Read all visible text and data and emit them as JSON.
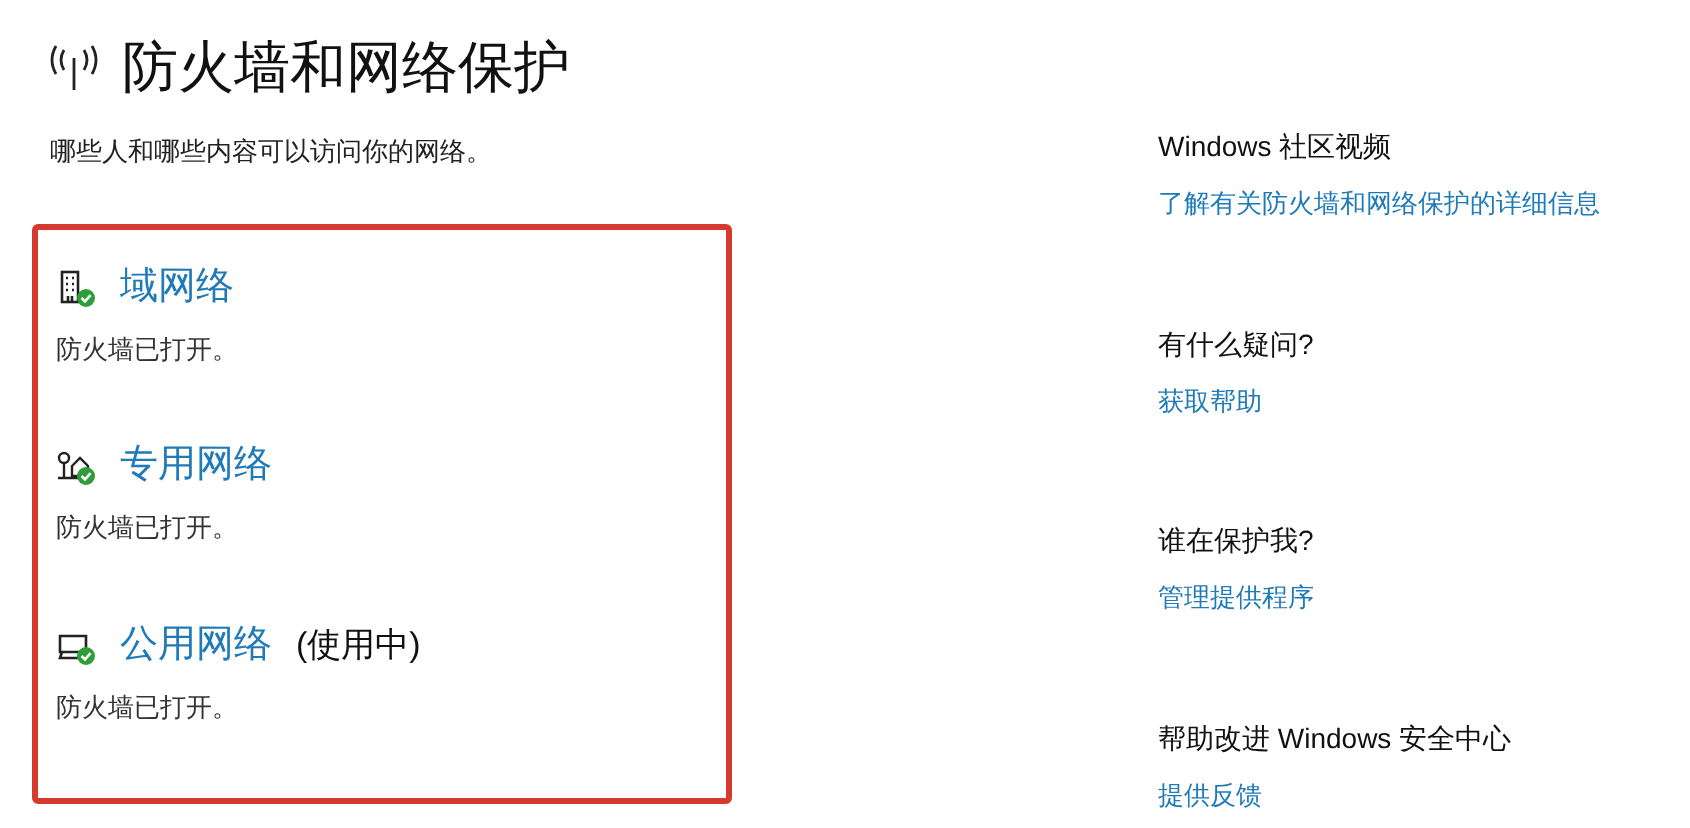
{
  "page": {
    "title": "防火墙和网络保护",
    "subtitle": "哪些人和哪些内容可以访问你的网络。"
  },
  "networks": [
    {
      "kind": "domain",
      "name": "域网络",
      "status": "防火墙已打开。"
    },
    {
      "kind": "private",
      "name": "专用网络",
      "status": "防火墙已打开。"
    },
    {
      "kind": "public",
      "name": "公用网络",
      "note": "(使用中)",
      "status": "防火墙已打开。"
    }
  ],
  "side_sections": [
    {
      "heading": "Windows 社区视频",
      "link": "了解有关防火墙和网络保护的详细信息"
    },
    {
      "heading": "有什么疑问?",
      "link": "获取帮助"
    },
    {
      "heading": "谁在保护我?",
      "link": "管理提供程序"
    },
    {
      "heading": "帮助改进 Windows 安全中心",
      "link": "提供反馈"
    }
  ]
}
